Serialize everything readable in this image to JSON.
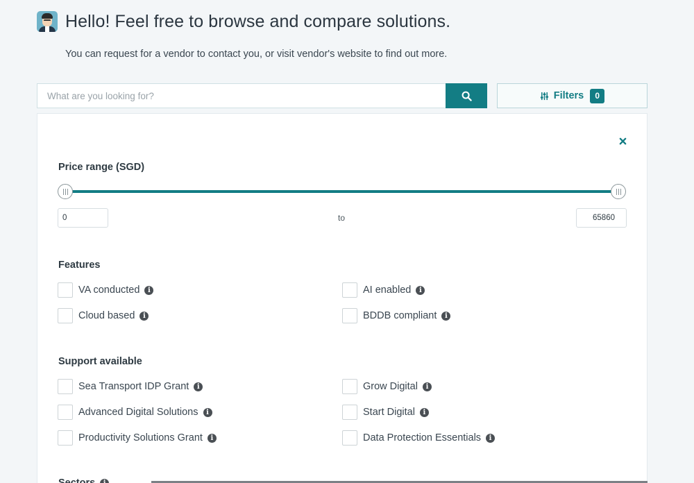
{
  "header": {
    "title": "Hello! Feel free to browse and compare solutions.",
    "subtitle": "You can request for a vendor to contact you, or visit vendor's website to find out more."
  },
  "search": {
    "placeholder": "What are you looking for?",
    "value": ""
  },
  "filters_button": {
    "label": "Filters",
    "count": "0"
  },
  "filter_panel": {
    "price_range": {
      "title": "Price range (SGD)",
      "min_value": "0",
      "max_value": "65860",
      "to_label": "to",
      "slider_low_fraction": 0,
      "slider_high_fraction": 1
    },
    "features": {
      "title": "Features",
      "items": [
        {
          "label": "VA conducted"
        },
        {
          "label": "AI enabled"
        },
        {
          "label": "Cloud based"
        },
        {
          "label": "BDDB compliant"
        }
      ]
    },
    "support": {
      "title": "Support available",
      "items": [
        {
          "label": "Sea Transport IDP Grant"
        },
        {
          "label": "Grow Digital"
        },
        {
          "label": "Advanced Digital Solutions"
        },
        {
          "label": "Start Digital"
        },
        {
          "label": "Productivity Solutions Grant"
        },
        {
          "label": "Data Protection Essentials"
        }
      ]
    },
    "sectors": {
      "title": "Sectors"
    }
  },
  "colors": {
    "accent": "#137d84",
    "background": "#f3f6f8"
  }
}
